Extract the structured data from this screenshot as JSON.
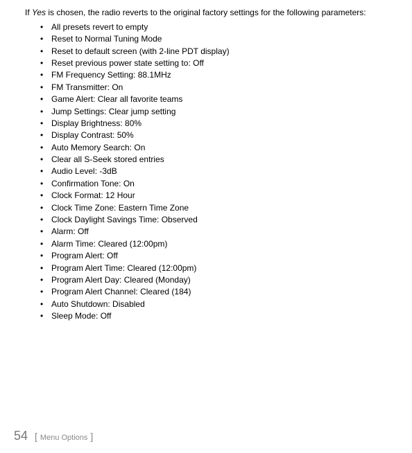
{
  "intro": {
    "prefix": "If ",
    "italic": "Yes",
    "suffix": " is chosen, the radio reverts to the original factory settings for the following parameters:"
  },
  "bullets": [
    "All presets revert to empty",
    "Reset to Normal Tuning Mode",
    "Reset to default screen (with 2-line PDT display)",
    "Reset previous power state setting to: Off",
    "FM Frequency Setting: 88.1MHz",
    "FM Transmitter: On",
    "Game Alert: Clear all favorite teams",
    "Jump Settings: Clear jump setting",
    "Display Brightness: 80%",
    "Display Contrast: 50%",
    "Auto Memory Search: On",
    "Clear all S-Seek stored entries",
    "Audio Level: -3dB",
    "Confirmation Tone: On",
    "Clock Format: 12 Hour",
    "Clock Time Zone: Eastern Time Zone",
    "Clock Daylight Savings Time: Observed",
    "Alarm: Off",
    "Alarm Time: Cleared (12:00pm)",
    "Program Alert: Off",
    "Program Alert Time: Cleared (12:00pm)",
    "Program Alert Day: Cleared (Monday)",
    "Program Alert Channel: Cleared (184)",
    "Auto Shutdown: Disabled",
    "Sleep Mode: Off"
  ],
  "footer": {
    "page_number": "54",
    "bracket_open": "[",
    "section_name": "Menu Options",
    "bracket_close": "]"
  }
}
